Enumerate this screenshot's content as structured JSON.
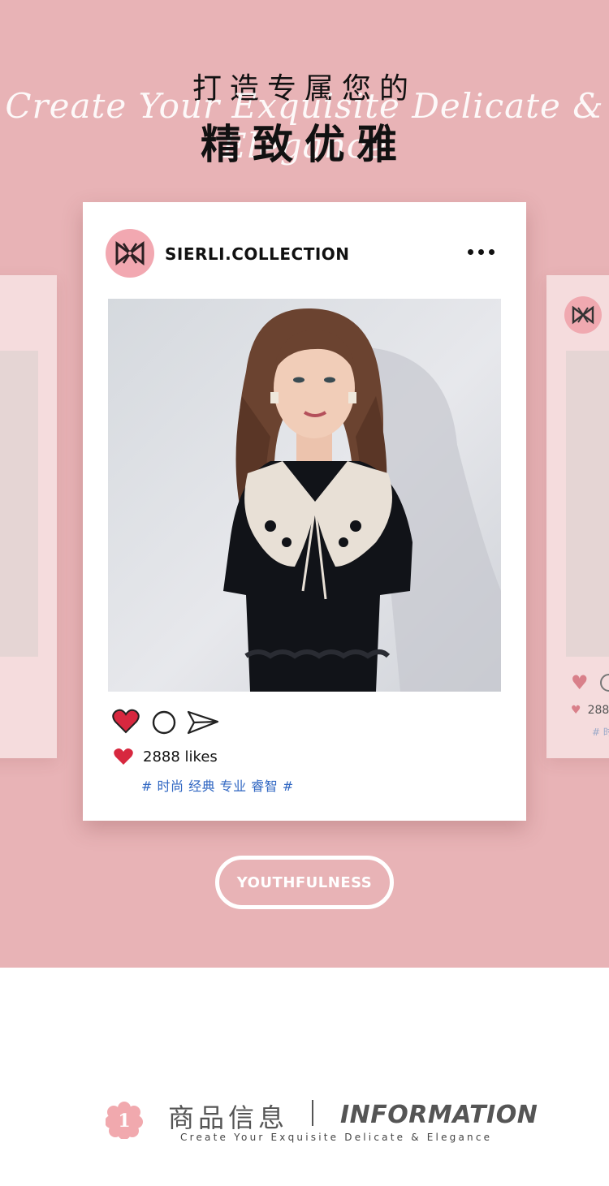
{
  "colors": {
    "banner_bg": "#e8b3b6",
    "card_bg": "#ffffff",
    "logo_pink": "#f2a8b1",
    "heart_red": "#d7283f",
    "tag_blue": "#2f66c2",
    "text_dark": "#111111",
    "info_gray": "#555555"
  },
  "header": {
    "title_top": "打造专属您的",
    "script_line": "Create Your Exquisite Delicate & Elegance",
    "title_main": "精致优雅"
  },
  "post": {
    "username": "SIERLI.COLLECTION",
    "logo_icon": "sierli-monogram-icon",
    "more_icon": "more-dots-icon",
    "photo_alt": "product-photo",
    "likes_text": "2888 likes",
    "tags": "# 时尚 经典 专业 睿智 #"
  },
  "side_card_right": {
    "likes_text": "288",
    "tag_text": "# 时"
  },
  "cta": {
    "label": "YOUTHFULNESS"
  },
  "info_section": {
    "number": "1",
    "title_cn": "商品信息",
    "title_en": "INFORMATION",
    "subtitle": "Create Your Exquisite Delicate & Elegance"
  }
}
